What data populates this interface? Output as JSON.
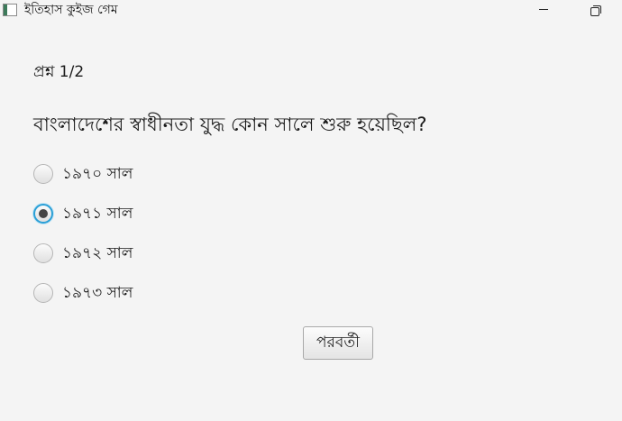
{
  "window": {
    "title": "ইতিহাস কুইজ গেম",
    "icon": "app-window-icon",
    "controls": [
      "minimize-icon",
      "restore-icon"
    ]
  },
  "quiz": {
    "counter": "প্রশ্ন 1/2",
    "question": "বাংলাদেশের স্বাধীনতা যুদ্ধ কোন সালে শুরু হয়েছিল?",
    "options": [
      {
        "label": "১৯৭০ সাল",
        "selected": false
      },
      {
        "label": "১৯৭১ সাল",
        "selected": true
      },
      {
        "label": "১৯৭২ সাল",
        "selected": false
      },
      {
        "label": "১৯৭৩ সাল",
        "selected": false
      }
    ],
    "next_label": "পরবর্তী"
  },
  "colors": {
    "background": "#f4f4f4",
    "focus_ring": "#2a9fd6",
    "radio_dot": "#444444"
  }
}
